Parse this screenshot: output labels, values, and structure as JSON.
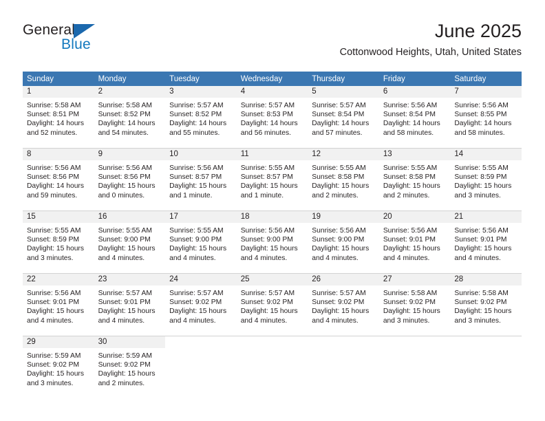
{
  "brand": {
    "name_part1": "General",
    "name_part2": "Blue",
    "triangle_color": "#1b68ad",
    "blue_color": "#1278be"
  },
  "header": {
    "title": "June 2025",
    "location": "Cottonwood Heights, Utah, United States"
  },
  "theme": {
    "header_blue": "#3b77b2",
    "daynum_band": "#f1f1f1",
    "grid_line": "#d2d2d2"
  },
  "weekday_headers": [
    "Sunday",
    "Monday",
    "Tuesday",
    "Wednesday",
    "Thursday",
    "Friday",
    "Saturday"
  ],
  "weeks": [
    [
      {
        "day": "1",
        "sunrise": "Sunrise: 5:58 AM",
        "sunset": "Sunset: 8:51 PM",
        "daylight_line1": "Daylight: 14 hours",
        "daylight_line2": "and 52 minutes."
      },
      {
        "day": "2",
        "sunrise": "Sunrise: 5:58 AM",
        "sunset": "Sunset: 8:52 PM",
        "daylight_line1": "Daylight: 14 hours",
        "daylight_line2": "and 54 minutes."
      },
      {
        "day": "3",
        "sunrise": "Sunrise: 5:57 AM",
        "sunset": "Sunset: 8:52 PM",
        "daylight_line1": "Daylight: 14 hours",
        "daylight_line2": "and 55 minutes."
      },
      {
        "day": "4",
        "sunrise": "Sunrise: 5:57 AM",
        "sunset": "Sunset: 8:53 PM",
        "daylight_line1": "Daylight: 14 hours",
        "daylight_line2": "and 56 minutes."
      },
      {
        "day": "5",
        "sunrise": "Sunrise: 5:57 AM",
        "sunset": "Sunset: 8:54 PM",
        "daylight_line1": "Daylight: 14 hours",
        "daylight_line2": "and 57 minutes."
      },
      {
        "day": "6",
        "sunrise": "Sunrise: 5:56 AM",
        "sunset": "Sunset: 8:54 PM",
        "daylight_line1": "Daylight: 14 hours",
        "daylight_line2": "and 58 minutes."
      },
      {
        "day": "7",
        "sunrise": "Sunrise: 5:56 AM",
        "sunset": "Sunset: 8:55 PM",
        "daylight_line1": "Daylight: 14 hours",
        "daylight_line2": "and 58 minutes."
      }
    ],
    [
      {
        "day": "8",
        "sunrise": "Sunrise: 5:56 AM",
        "sunset": "Sunset: 8:56 PM",
        "daylight_line1": "Daylight: 14 hours",
        "daylight_line2": "and 59 minutes."
      },
      {
        "day": "9",
        "sunrise": "Sunrise: 5:56 AM",
        "sunset": "Sunset: 8:56 PM",
        "daylight_line1": "Daylight: 15 hours",
        "daylight_line2": "and 0 minutes."
      },
      {
        "day": "10",
        "sunrise": "Sunrise: 5:56 AM",
        "sunset": "Sunset: 8:57 PM",
        "daylight_line1": "Daylight: 15 hours",
        "daylight_line2": "and 1 minute."
      },
      {
        "day": "11",
        "sunrise": "Sunrise: 5:55 AM",
        "sunset": "Sunset: 8:57 PM",
        "daylight_line1": "Daylight: 15 hours",
        "daylight_line2": "and 1 minute."
      },
      {
        "day": "12",
        "sunrise": "Sunrise: 5:55 AM",
        "sunset": "Sunset: 8:58 PM",
        "daylight_line1": "Daylight: 15 hours",
        "daylight_line2": "and 2 minutes."
      },
      {
        "day": "13",
        "sunrise": "Sunrise: 5:55 AM",
        "sunset": "Sunset: 8:58 PM",
        "daylight_line1": "Daylight: 15 hours",
        "daylight_line2": "and 2 minutes."
      },
      {
        "day": "14",
        "sunrise": "Sunrise: 5:55 AM",
        "sunset": "Sunset: 8:59 PM",
        "daylight_line1": "Daylight: 15 hours",
        "daylight_line2": "and 3 minutes."
      }
    ],
    [
      {
        "day": "15",
        "sunrise": "Sunrise: 5:55 AM",
        "sunset": "Sunset: 8:59 PM",
        "daylight_line1": "Daylight: 15 hours",
        "daylight_line2": "and 3 minutes."
      },
      {
        "day": "16",
        "sunrise": "Sunrise: 5:55 AM",
        "sunset": "Sunset: 9:00 PM",
        "daylight_line1": "Daylight: 15 hours",
        "daylight_line2": "and 4 minutes."
      },
      {
        "day": "17",
        "sunrise": "Sunrise: 5:55 AM",
        "sunset": "Sunset: 9:00 PM",
        "daylight_line1": "Daylight: 15 hours",
        "daylight_line2": "and 4 minutes."
      },
      {
        "day": "18",
        "sunrise": "Sunrise: 5:56 AM",
        "sunset": "Sunset: 9:00 PM",
        "daylight_line1": "Daylight: 15 hours",
        "daylight_line2": "and 4 minutes."
      },
      {
        "day": "19",
        "sunrise": "Sunrise: 5:56 AM",
        "sunset": "Sunset: 9:00 PM",
        "daylight_line1": "Daylight: 15 hours",
        "daylight_line2": "and 4 minutes."
      },
      {
        "day": "20",
        "sunrise": "Sunrise: 5:56 AM",
        "sunset": "Sunset: 9:01 PM",
        "daylight_line1": "Daylight: 15 hours",
        "daylight_line2": "and 4 minutes."
      },
      {
        "day": "21",
        "sunrise": "Sunrise: 5:56 AM",
        "sunset": "Sunset: 9:01 PM",
        "daylight_line1": "Daylight: 15 hours",
        "daylight_line2": "and 4 minutes."
      }
    ],
    [
      {
        "day": "22",
        "sunrise": "Sunrise: 5:56 AM",
        "sunset": "Sunset: 9:01 PM",
        "daylight_line1": "Daylight: 15 hours",
        "daylight_line2": "and 4 minutes."
      },
      {
        "day": "23",
        "sunrise": "Sunrise: 5:57 AM",
        "sunset": "Sunset: 9:01 PM",
        "daylight_line1": "Daylight: 15 hours",
        "daylight_line2": "and 4 minutes."
      },
      {
        "day": "24",
        "sunrise": "Sunrise: 5:57 AM",
        "sunset": "Sunset: 9:02 PM",
        "daylight_line1": "Daylight: 15 hours",
        "daylight_line2": "and 4 minutes."
      },
      {
        "day": "25",
        "sunrise": "Sunrise: 5:57 AM",
        "sunset": "Sunset: 9:02 PM",
        "daylight_line1": "Daylight: 15 hours",
        "daylight_line2": "and 4 minutes."
      },
      {
        "day": "26",
        "sunrise": "Sunrise: 5:57 AM",
        "sunset": "Sunset: 9:02 PM",
        "daylight_line1": "Daylight: 15 hours",
        "daylight_line2": "and 4 minutes."
      },
      {
        "day": "27",
        "sunrise": "Sunrise: 5:58 AM",
        "sunset": "Sunset: 9:02 PM",
        "daylight_line1": "Daylight: 15 hours",
        "daylight_line2": "and 3 minutes."
      },
      {
        "day": "28",
        "sunrise": "Sunrise: 5:58 AM",
        "sunset": "Sunset: 9:02 PM",
        "daylight_line1": "Daylight: 15 hours",
        "daylight_line2": "and 3 minutes."
      }
    ],
    [
      {
        "day": "29",
        "sunrise": "Sunrise: 5:59 AM",
        "sunset": "Sunset: 9:02 PM",
        "daylight_line1": "Daylight: 15 hours",
        "daylight_line2": "and 3 minutes."
      },
      {
        "day": "30",
        "sunrise": "Sunrise: 5:59 AM",
        "sunset": "Sunset: 9:02 PM",
        "daylight_line1": "Daylight: 15 hours",
        "daylight_line2": "and 2 minutes."
      },
      {
        "day": "",
        "sunrise": "",
        "sunset": "",
        "daylight_line1": "",
        "daylight_line2": ""
      },
      {
        "day": "",
        "sunrise": "",
        "sunset": "",
        "daylight_line1": "",
        "daylight_line2": ""
      },
      {
        "day": "",
        "sunrise": "",
        "sunset": "",
        "daylight_line1": "",
        "daylight_line2": ""
      },
      {
        "day": "",
        "sunrise": "",
        "sunset": "",
        "daylight_line1": "",
        "daylight_line2": ""
      },
      {
        "day": "",
        "sunrise": "",
        "sunset": "",
        "daylight_line1": "",
        "daylight_line2": ""
      }
    ]
  ]
}
